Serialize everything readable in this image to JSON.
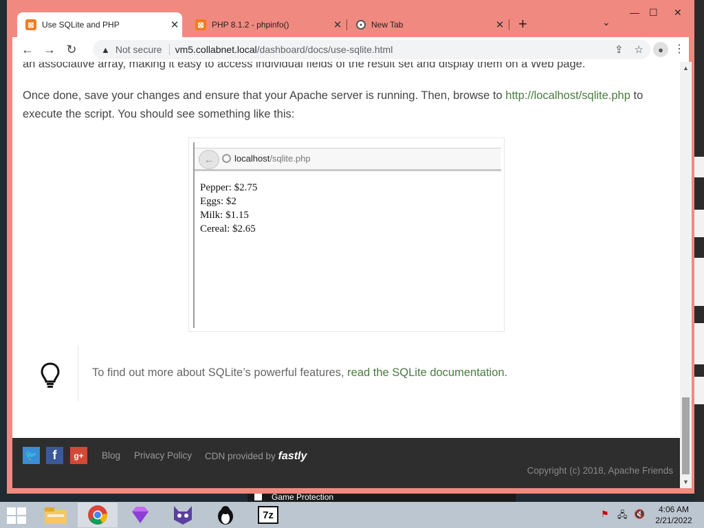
{
  "browser": {
    "tabs": [
      {
        "label": "Use SQLite and PHP",
        "favicon": "xampp-icon",
        "active": true
      },
      {
        "label": "PHP 8.1.2 - phpinfo()",
        "favicon": "xampp-icon",
        "active": false
      },
      {
        "label": "New Tab",
        "favicon": "chrome-icon",
        "active": false
      }
    ],
    "new_tab": "+",
    "security_label": "Not secure",
    "url_host": "vm5.collabnet.local",
    "url_path": "/dashboard/docs/use-sqlite.html",
    "frame_color": "#f08a80"
  },
  "page": {
    "top_line": "an associative array, making it easy to access individual fields of the result set and display them on a Web page.",
    "para_before": "Once done, save your changes and ensure that your Apache server is running. Then, browse to ",
    "para_link": "http://localhost/sqlite.php",
    "para_after": " to execute the script. You should see something like this:",
    "link_color": "#4a7a3f",
    "screenshot": {
      "url_host": "localhost",
      "url_path": "/sqlite.php",
      "lines": [
        "Pepper: $2.75",
        "Eggs: $2",
        "Milk: $1.15",
        "Cereal: $2.65"
      ]
    },
    "tip_text": "To find out more about SQLite’s powerful features, ",
    "tip_link": "read the SQLite documentation",
    "tip_end": "."
  },
  "footer": {
    "links": [
      "Blog",
      "Privacy Policy"
    ],
    "cdn_text": "CDN provided by",
    "cdn_brand": "fastly",
    "copyright": "Copyright (c) 2018, Apache Friends",
    "social": [
      "twitter-icon",
      "facebook-icon",
      "google-plus-icon"
    ]
  },
  "desktop": {
    "game_protection": "Game Protection"
  },
  "taskbar": {
    "apps": [
      "file-explorer-icon",
      "chrome-icon",
      "gem-icon",
      "cat-icon",
      "penguin-icon",
      "7zip-icon"
    ],
    "sevenzip_label": "7z",
    "time": "4:06 AM",
    "date": "2/21/2022"
  }
}
